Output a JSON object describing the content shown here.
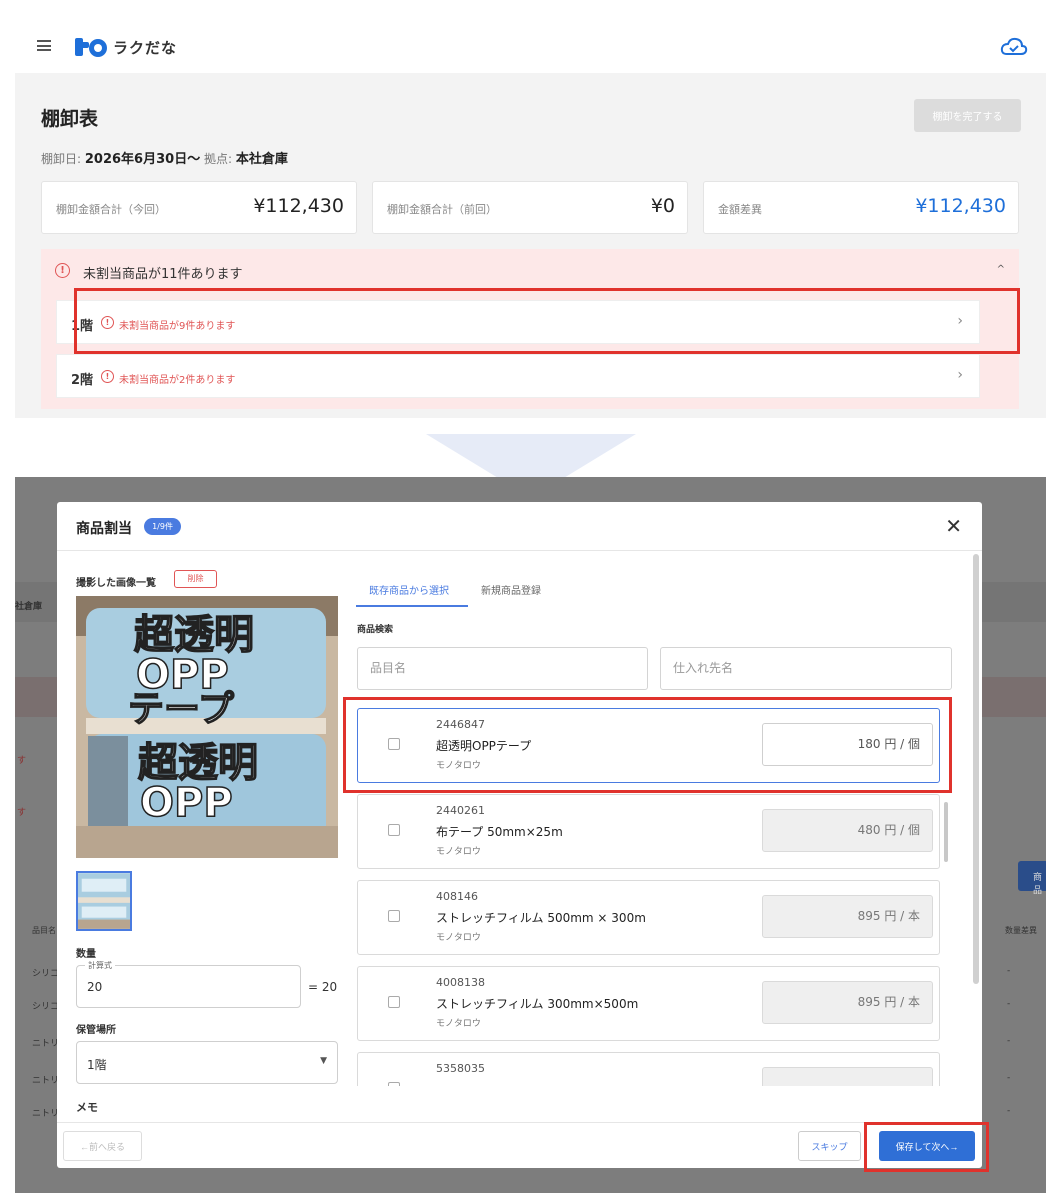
{
  "app": {
    "name": "ラクだな"
  },
  "top": {
    "title": "棚卸表",
    "complete_button": "棚卸を完了する",
    "meta": {
      "date_label": "棚卸日:",
      "date_value": "2026年6月30日〜",
      "location_label": "拠点:",
      "location_value": "本社倉庫"
    },
    "summary": [
      {
        "label": "棚卸金額合計（今回）",
        "value": "¥112,430"
      },
      {
        "label": "棚卸金額合計（前回）",
        "value": "¥0"
      },
      {
        "label": "金額差異",
        "value": "¥112,430"
      }
    ],
    "alert": {
      "title": "未割当商品が11件あります",
      "rows": [
        {
          "name": "1階",
          "message": "未割当商品が9件あります"
        },
        {
          "name": "2階",
          "message": "未割当商品が2件あります"
        }
      ]
    }
  },
  "modal": {
    "title": "商品割当",
    "badge": "1/9件",
    "left": {
      "images_title": "撮影した画像一覧",
      "delete_button": "削除",
      "photo_text": {
        "line1": "超透明",
        "line2": "OPP",
        "line3": "テープ"
      },
      "quantity_label": "数量",
      "formula_legend": "計算式",
      "formula_value": "20",
      "result": "= 20",
      "storage_label": "保管場所",
      "storage_value": "1階",
      "memo_label": "メモ"
    },
    "tabs": [
      {
        "label": "既存商品から選択"
      },
      {
        "label": "新規商品登録"
      }
    ],
    "search": {
      "label": "商品検索",
      "name_placeholder": "品目名",
      "supplier_placeholder": "仕入れ先名"
    },
    "products": [
      {
        "code": "2446847",
        "name": "超透明OPPテープ",
        "maker": "モノタロウ",
        "price": "180 円 / 個"
      },
      {
        "code": "2440261",
        "name": "布テープ 50mm×25m",
        "maker": "モノタロウ",
        "price": "480 円 / 個"
      },
      {
        "code": "408146",
        "name": "ストレッチフィルム 500mm × 300m",
        "maker": "モノタロウ",
        "price": "895 円 / 本"
      },
      {
        "code": "4008138",
        "name": "ストレッチフィルム 300mm×500m",
        "maker": "モノタロウ",
        "price": "895 円 / 本"
      },
      {
        "code": "5358035",
        "name": "",
        "maker": "",
        "price": ""
      }
    ],
    "footer": {
      "prev": "←前へ戻る",
      "skip": "スキップ",
      "save_next": "保存して次へ→"
    }
  },
  "background": {
    "location": "社倉庫",
    "col1": "品目名",
    "col2": "数量差異",
    "rows": [
      "シリコ",
      "シリコ",
      "ニトリ",
      "ニトリ",
      "ニトリ"
    ],
    "dash": "-",
    "marks": [
      "す",
      "す"
    ],
    "btn": "商品"
  },
  "colors": {
    "accent": "#4a7be0",
    "warning": "#e05555",
    "highlight": "#e0322c"
  }
}
